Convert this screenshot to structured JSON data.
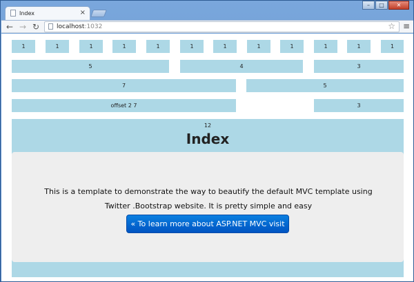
{
  "browser": {
    "tab_title": "Index",
    "tab_close": "×",
    "url_host": "localhost",
    "url_port": ":1032",
    "window_buttons": {
      "minimize": "–",
      "maximize": "□",
      "close": "✕"
    },
    "nav": {
      "back": "←",
      "forward": "→",
      "reload": "↻",
      "star": "☆",
      "menu": "≡"
    }
  },
  "grid": {
    "row1": [
      "1",
      "1",
      "1",
      "1",
      "1",
      "1",
      "1",
      "1",
      "1",
      "1",
      "1",
      "1"
    ],
    "row2": [
      "5",
      "4",
      "3"
    ],
    "row3": [
      "7",
      "5"
    ],
    "row4": [
      "offset 2 7",
      "3"
    ]
  },
  "hero": {
    "span_label": "12",
    "title": "Index",
    "text": "This is a template to demonstrate the way to beautify the default MVC template using Twitter .Bootstrap website. It is pretty simple and easy",
    "button_label": "« To learn more about ASP.NET MVC visit"
  },
  "colors": {
    "span_bg": "#add8e6",
    "jumbotron_bg": "#eeeeee",
    "button": "#0066cc"
  }
}
